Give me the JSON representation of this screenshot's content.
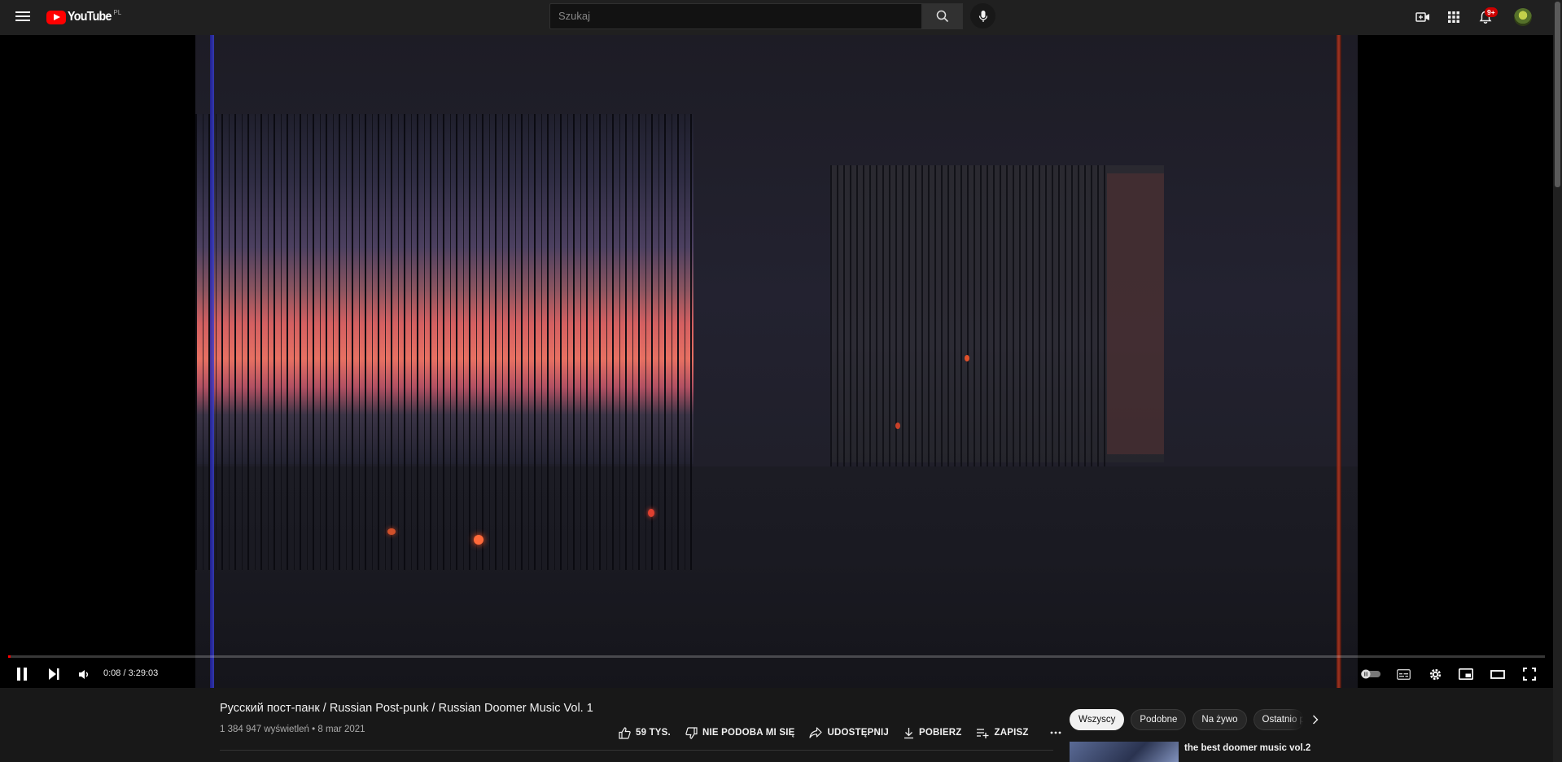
{
  "masthead": {
    "logo_text": "YouTube",
    "country_code": "PL",
    "search_placeholder": "Szukaj",
    "notifications_count": "9+"
  },
  "player": {
    "time_current": "0:08",
    "time_total": "3:29:03",
    "time_display": "0:08 / 3:29:03",
    "progress_fraction": 0.0006,
    "accent_color": "#ff0000"
  },
  "video": {
    "title": "Русский пост-панк / Russian Post-punk / Russian Doomer Music Vol. 1",
    "views_date": "1 384 947 wyświetleń • 8 mar 2021"
  },
  "actions": {
    "like_count": "59 TYS.",
    "dislike_label": "NIE PODOBA MI SIĘ",
    "share_label": "UDOSTĘPNIJ",
    "download_label": "POBIERZ",
    "save_label": "ZAPISZ"
  },
  "chips": [
    "Wszyscy",
    "Podobne",
    "Na żywo",
    "Ostatnio przesłane"
  ],
  "recommendations": [
    {
      "title": "the best doomer music vol.2",
      "channel": ""
    }
  ]
}
